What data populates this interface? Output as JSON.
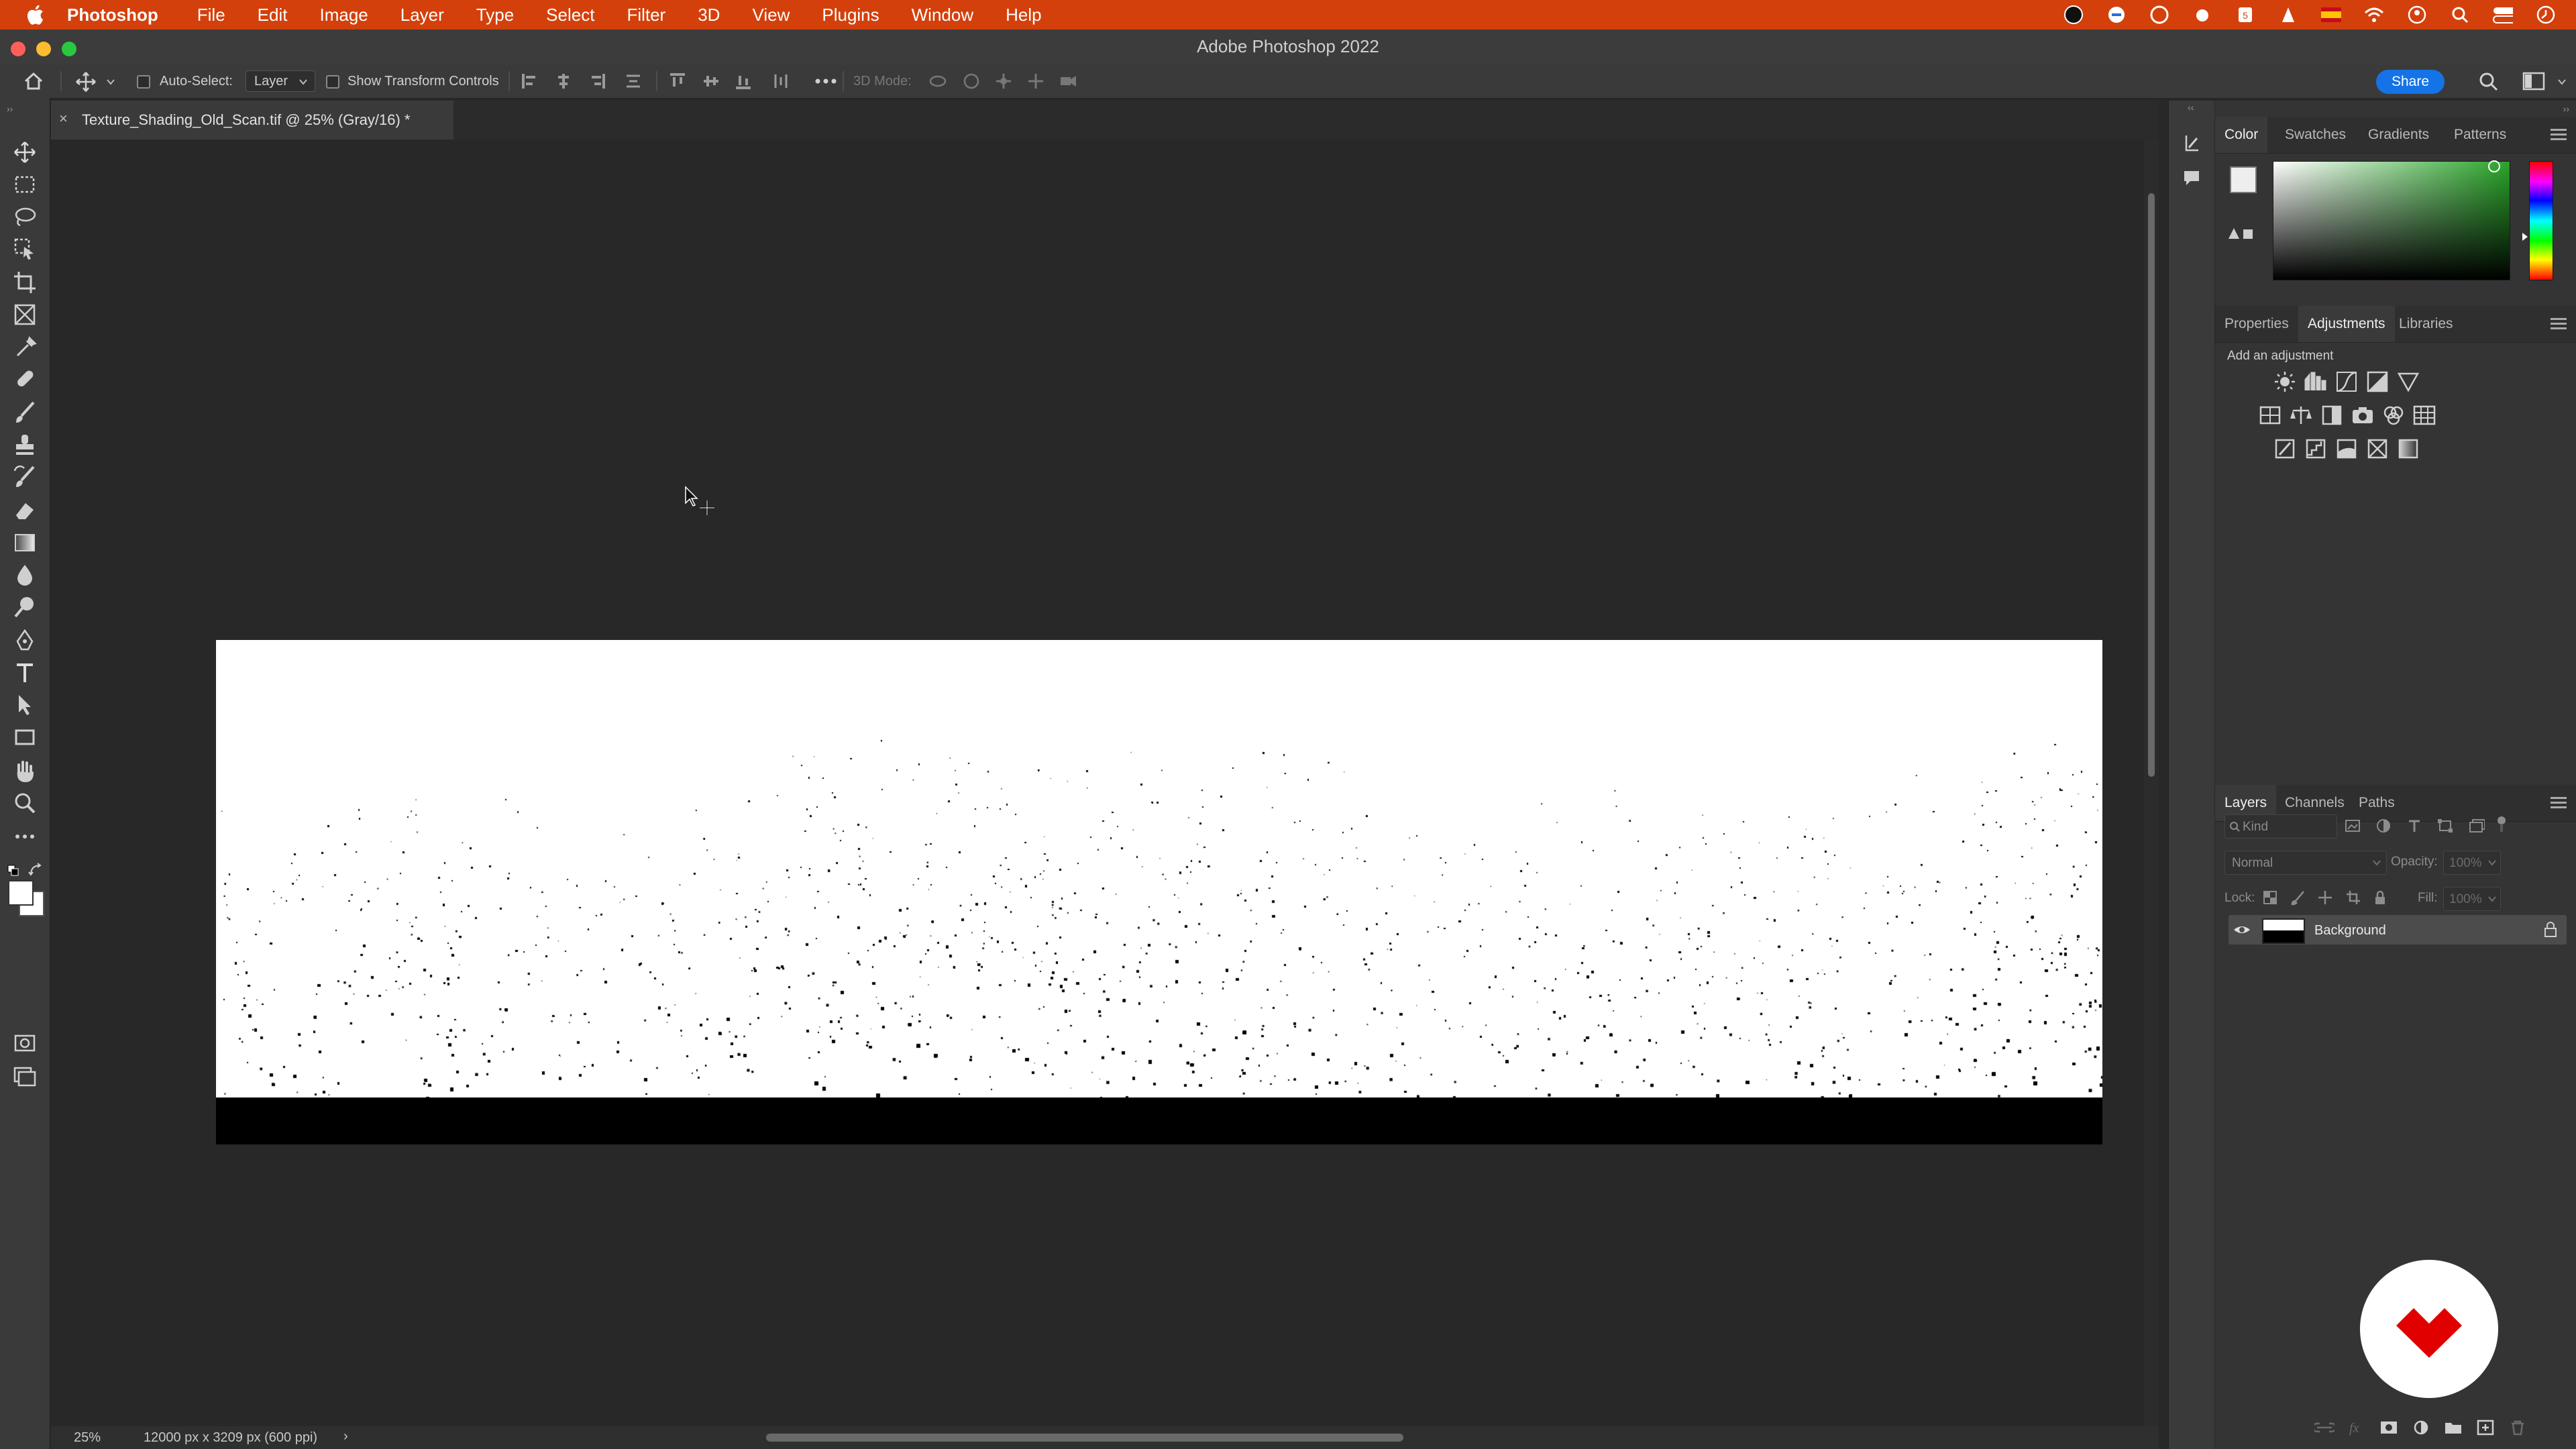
{
  "menubar": {
    "app_name": "Photoshop",
    "items": [
      "File",
      "Edit",
      "Image",
      "Layer",
      "Type",
      "Select",
      "Filter",
      "3D",
      "View",
      "Plugins",
      "Window",
      "Help"
    ],
    "color": "#d4400c"
  },
  "window": {
    "title": "Adobe Photoshop 2022"
  },
  "options": {
    "auto_select_label": "Auto-Select:",
    "auto_select_target": "Layer",
    "show_transform_label": "Show Transform Controls",
    "mode_label": "3D Mode:",
    "share_label": "Share",
    "share_color": "#1473e6"
  },
  "document": {
    "tab_label": "Texture_Shading_Old_Scan.tif @ 25% (Gray/16) *",
    "close_glyph": "×"
  },
  "status": {
    "zoom": "25%",
    "doc_info": "12000 px x 3209 px (600 ppi)",
    "arrow": "›"
  },
  "panels": {
    "color_tabs": [
      "Color",
      "Swatches",
      "Gradients",
      "Patterns"
    ],
    "props_tabs": [
      "Properties",
      "Adjustments",
      "Libraries"
    ],
    "adjust_label": "Add an adjustment",
    "layers_tabs": [
      "Layers",
      "Channels",
      "Paths"
    ],
    "kind_placeholder": "Kind",
    "blend_mode": "Normal",
    "opacity_label": "Opacity:",
    "opacity_value": "100%",
    "lock_label": "Lock:",
    "fill_label": "Fill:",
    "fill_value": "100%",
    "layer_name": "Background"
  },
  "icons": {
    "toolbar": [
      "move-icon",
      "marquee-icon",
      "lasso-icon",
      "object-select-icon",
      "crop-icon",
      "frame-icon",
      "eyedropper-icon",
      "healing-icon",
      "brush-icon",
      "stamp-icon",
      "history-brush-icon",
      "eraser-icon",
      "gradient-icon",
      "blur-icon",
      "dodge-icon",
      "pen-icon",
      "type-icon",
      "path-select-icon",
      "rectangle-icon",
      "hand-icon",
      "zoom-icon",
      "more-tools-icon"
    ]
  }
}
